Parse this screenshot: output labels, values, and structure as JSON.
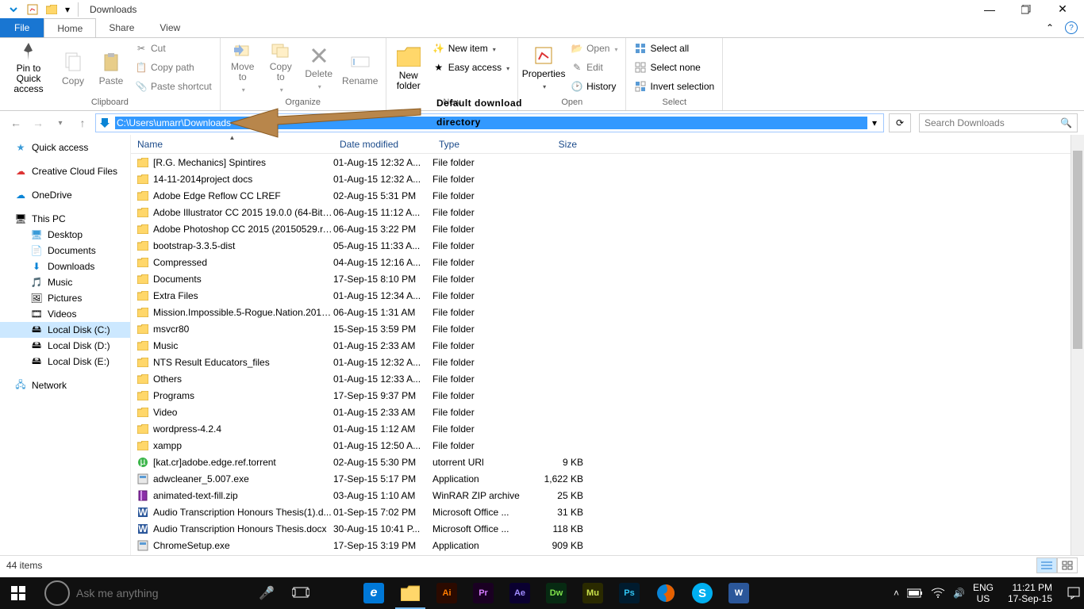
{
  "window": {
    "title": "Downloads"
  },
  "tabs": {
    "file": "File",
    "home": "Home",
    "share": "Share",
    "view": "View"
  },
  "ribbon": {
    "clipboard": {
      "label": "Clipboard",
      "pin": "Pin to Quick\naccess",
      "copy": "Copy",
      "paste": "Paste",
      "cut": "Cut",
      "copy_path": "Copy path",
      "paste_shortcut": "Paste shortcut"
    },
    "organize": {
      "label": "Organize",
      "move_to": "Move\nto",
      "copy_to": "Copy\nto",
      "delete": "Delete",
      "rename": "Rename"
    },
    "new": {
      "label": "New",
      "new_folder": "New\nfolder",
      "new_item": "New item",
      "easy_access": "Easy access"
    },
    "open": {
      "label": "Open",
      "properties": "Properties",
      "open": "Open",
      "edit": "Edit",
      "history": "History"
    },
    "select": {
      "label": "Select",
      "select_all": "Select all",
      "select_none": "Select none",
      "invert": "Invert selection"
    }
  },
  "annotation": {
    "line1": "Default download",
    "line2": "directory"
  },
  "address": {
    "path": "C:\\Users\\umarr\\Downloads",
    "search_placeholder": "Search Downloads"
  },
  "nav": {
    "quick_access": "Quick access",
    "creative_cloud": "Creative Cloud Files",
    "onedrive": "OneDrive",
    "this_pc": "This PC",
    "desktop": "Desktop",
    "documents": "Documents",
    "downloads": "Downloads",
    "music": "Music",
    "pictures": "Pictures",
    "videos": "Videos",
    "disk_c": "Local Disk (C:)",
    "disk_d": "Local Disk (D:)",
    "disk_e": "Local Disk (E:)",
    "network": "Network"
  },
  "columns": {
    "name": "Name",
    "date": "Date modified",
    "type": "Type",
    "size": "Size"
  },
  "files": [
    {
      "icon": "folder",
      "name": "[R.G. Mechanics] Spintires",
      "date": "01-Aug-15 12:32 A...",
      "type": "File folder",
      "size": ""
    },
    {
      "icon": "folder",
      "name": "14-11-2014project docs",
      "date": "01-Aug-15 12:32 A...",
      "type": "File folder",
      "size": ""
    },
    {
      "icon": "folder",
      "name": "Adobe Edge Reflow CC LREF",
      "date": "02-Aug-15 5:31 PM",
      "type": "File folder",
      "size": ""
    },
    {
      "icon": "folder",
      "name": "Adobe Illustrator CC 2015 19.0.0 (64-Bit) ...",
      "date": "06-Aug-15 11:12 A...",
      "type": "File folder",
      "size": ""
    },
    {
      "icon": "folder",
      "name": "Adobe Photoshop CC 2015 (20150529.r.8...",
      "date": "06-Aug-15 3:22 PM",
      "type": "File folder",
      "size": ""
    },
    {
      "icon": "folder",
      "name": "bootstrap-3.3.5-dist",
      "date": "05-Aug-15 11:33 A...",
      "type": "File folder",
      "size": ""
    },
    {
      "icon": "folder",
      "name": "Compressed",
      "date": "04-Aug-15 12:16 A...",
      "type": "File folder",
      "size": ""
    },
    {
      "icon": "folder",
      "name": "Documents",
      "date": "17-Sep-15 8:10 PM",
      "type": "File folder",
      "size": ""
    },
    {
      "icon": "folder",
      "name": "Extra Files",
      "date": "01-Aug-15 12:34 A...",
      "type": "File folder",
      "size": ""
    },
    {
      "icon": "folder",
      "name": "Mission.Impossible.5-Rogue.Nation.2015...",
      "date": "06-Aug-15 1:31 AM",
      "type": "File folder",
      "size": ""
    },
    {
      "icon": "folder",
      "name": "msvcr80",
      "date": "15-Sep-15 3:59 PM",
      "type": "File folder",
      "size": ""
    },
    {
      "icon": "folder",
      "name": "Music",
      "date": "01-Aug-15 2:33 AM",
      "type": "File folder",
      "size": ""
    },
    {
      "icon": "folder",
      "name": "NTS Result Educators_files",
      "date": "01-Aug-15 12:32 A...",
      "type": "File folder",
      "size": ""
    },
    {
      "icon": "folder",
      "name": "Others",
      "date": "01-Aug-15 12:33 A...",
      "type": "File folder",
      "size": ""
    },
    {
      "icon": "folder",
      "name": "Programs",
      "date": "17-Sep-15 9:37 PM",
      "type": "File folder",
      "size": ""
    },
    {
      "icon": "folder",
      "name": "Video",
      "date": "01-Aug-15 2:33 AM",
      "type": "File folder",
      "size": ""
    },
    {
      "icon": "folder",
      "name": "wordpress-4.2.4",
      "date": "01-Aug-15 1:12 AM",
      "type": "File folder",
      "size": ""
    },
    {
      "icon": "folder",
      "name": "xampp",
      "date": "01-Aug-15 12:50 A...",
      "type": "File folder",
      "size": ""
    },
    {
      "icon": "torrent",
      "name": "[kat.cr]adobe.edge.ref.torrent",
      "date": "02-Aug-15 5:30 PM",
      "type": "utorrent URl",
      "size": "9 KB"
    },
    {
      "icon": "exe",
      "name": "adwcleaner_5.007.exe",
      "date": "17-Sep-15 5:17 PM",
      "type": "Application",
      "size": "1,622 KB"
    },
    {
      "icon": "zip",
      "name": "animated-text-fill.zip",
      "date": "03-Aug-15 1:10 AM",
      "type": "WinRAR ZIP archive",
      "size": "25 KB"
    },
    {
      "icon": "word",
      "name": "Audio Transcription Honours Thesis(1).d...",
      "date": "01-Sep-15 7:02 PM",
      "type": "Microsoft Office ...",
      "size": "31 KB"
    },
    {
      "icon": "word",
      "name": "Audio Transcription Honours Thesis.docx",
      "date": "30-Aug-15 10:41 P...",
      "type": "Microsoft Office ...",
      "size": "118 KB"
    },
    {
      "icon": "exe",
      "name": "ChromeSetup.exe",
      "date": "17-Sep-15 3:19 PM",
      "type": "Application",
      "size": "909 KB"
    }
  ],
  "status": {
    "items": "44 items"
  },
  "taskbar": {
    "search_placeholder": "Ask me anything",
    "lang_top": "ENG",
    "lang_bot": "US",
    "time": "11:21 PM",
    "date": "17-Sep-15",
    "apps": [
      {
        "name": "task-view",
        "bg": "",
        "fg": "#fff",
        "label": ""
      },
      {
        "name": "edge",
        "bg": "#0078d7",
        "fg": "#fff",
        "label": "e"
      },
      {
        "name": "file-explorer",
        "bg": "#ffcf4b",
        "fg": "#7a5a00",
        "label": ""
      },
      {
        "name": "illustrator",
        "bg": "#2b0a00",
        "fg": "#ff7c00",
        "label": "Ai"
      },
      {
        "name": "premiere",
        "bg": "#1a0022",
        "fg": "#d77cff",
        "label": "Pr"
      },
      {
        "name": "after-effects",
        "bg": "#0a0030",
        "fg": "#a08cff",
        "label": "Ae"
      },
      {
        "name": "dreamweaver",
        "bg": "#072a12",
        "fg": "#7fe24b",
        "label": "Dw"
      },
      {
        "name": "muse",
        "bg": "#2a2a00",
        "fg": "#cbe24b",
        "label": "Mu"
      },
      {
        "name": "photoshop",
        "bg": "#001b2e",
        "fg": "#31c5f4",
        "label": "Ps"
      },
      {
        "name": "firefox",
        "bg": "#e66000",
        "fg": "#fff",
        "label": ""
      },
      {
        "name": "skype",
        "bg": "#00aff0",
        "fg": "#fff",
        "label": "S"
      },
      {
        "name": "word",
        "bg": "#2b579a",
        "fg": "#fff",
        "label": "W"
      }
    ]
  }
}
